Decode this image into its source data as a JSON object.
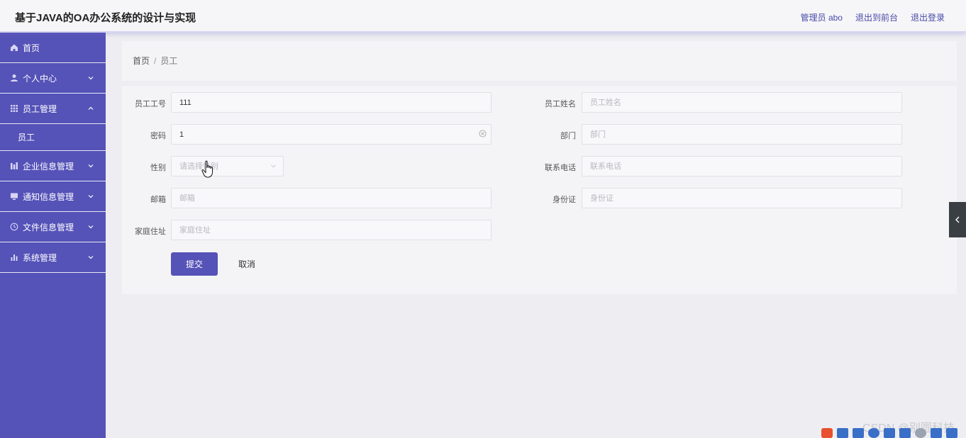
{
  "header": {
    "title": "基于JAVA的OA办公系统的设计与实现",
    "user_label": "管理员 abo",
    "to_front_label": "退出到前台",
    "logout_label": "退出登录"
  },
  "sidebar": {
    "items": [
      {
        "label": "首页",
        "icon": "home-icon",
        "expandable": false
      },
      {
        "label": "个人中心",
        "icon": "user-icon",
        "expandable": true,
        "expanded": false
      },
      {
        "label": "员工管理",
        "icon": "grid-icon",
        "expandable": true,
        "expanded": true,
        "children": [
          "员工"
        ]
      },
      {
        "label": "企业信息管理",
        "icon": "chart-bars-icon",
        "expandable": true,
        "expanded": false
      },
      {
        "label": "通知信息管理",
        "icon": "monitor-icon",
        "expandable": true,
        "expanded": false
      },
      {
        "label": "文件信息管理",
        "icon": "clock-icon",
        "expandable": true,
        "expanded": false
      },
      {
        "label": "系统管理",
        "icon": "bar-chart-icon",
        "expandable": true,
        "expanded": false
      }
    ]
  },
  "breadcrumb": {
    "home": "首页",
    "separator": "/",
    "current": "员工"
  },
  "form": {
    "fields": {
      "employee_no": {
        "label": "员工工号",
        "value": "111",
        "placeholder": "员工工号"
      },
      "employee_name": {
        "label": "员工姓名",
        "value": "",
        "placeholder": "员工姓名"
      },
      "password": {
        "label": "密码",
        "value": "1",
        "placeholder": "密码"
      },
      "department": {
        "label": "部门",
        "value": "",
        "placeholder": "部门"
      },
      "gender": {
        "label": "性别",
        "value": "",
        "placeholder": "请选择性别"
      },
      "phone": {
        "label": "联系电话",
        "value": "",
        "placeholder": "联系电话"
      },
      "email": {
        "label": "邮箱",
        "value": "",
        "placeholder": "邮箱"
      },
      "id_card": {
        "label": "身份证",
        "value": "",
        "placeholder": "身份证"
      },
      "address": {
        "label": "家庭住址",
        "value": "",
        "placeholder": "家庭住址"
      }
    },
    "submit_label": "提交",
    "cancel_label": "取消"
  },
  "watermark": "CSDN @别圆科技",
  "colors": {
    "sidebar": "#5552b8",
    "accent": "#5552b8",
    "link": "#4a4aa8",
    "page_bg": "#eeeef2"
  }
}
